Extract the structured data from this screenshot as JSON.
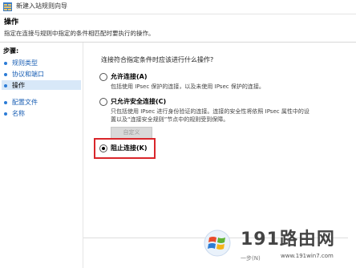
{
  "window": {
    "title": "新建入站规则向导"
  },
  "header": {
    "title": "操作",
    "description": "指定在连接与规则中指定的条件相匹配时要执行的操作。"
  },
  "steps": {
    "heading": "步骤:",
    "items": [
      {
        "label": "规则类型",
        "current": false
      },
      {
        "label": "协议和端口",
        "current": false
      },
      {
        "label": "操作",
        "current": true
      },
      {
        "label": "配置文件",
        "current": false
      },
      {
        "label": "名称",
        "current": false
      }
    ]
  },
  "content": {
    "question": "连接符合指定条件时应该进行什么操作?",
    "options": [
      {
        "label": "允许连接(A)",
        "description": "包括使用 IPsec 保护的连接，以及未使用 IPsec 保护的连接。",
        "checked": false
      },
      {
        "label": "只允许安全连接(C)",
        "description_line1": "只包括使用 IPsec 进行身份验证的连接。连接的安全性将依照 IPsec 属性中的设",
        "description_line2": "置以及“连接安全规则”节点中的规则受到保障。",
        "checked": false
      },
      {
        "label": "阻止连接(K)",
        "checked": true
      }
    ],
    "customize_button": "自定义"
  },
  "watermark": {
    "brand": "191路由网",
    "url": "www.191win7.com",
    "next_partial": "一步(N)"
  },
  "colors": {
    "highlight": "#d9262b",
    "link": "#1a5fb4",
    "step_dot": "#2a7bd6"
  }
}
